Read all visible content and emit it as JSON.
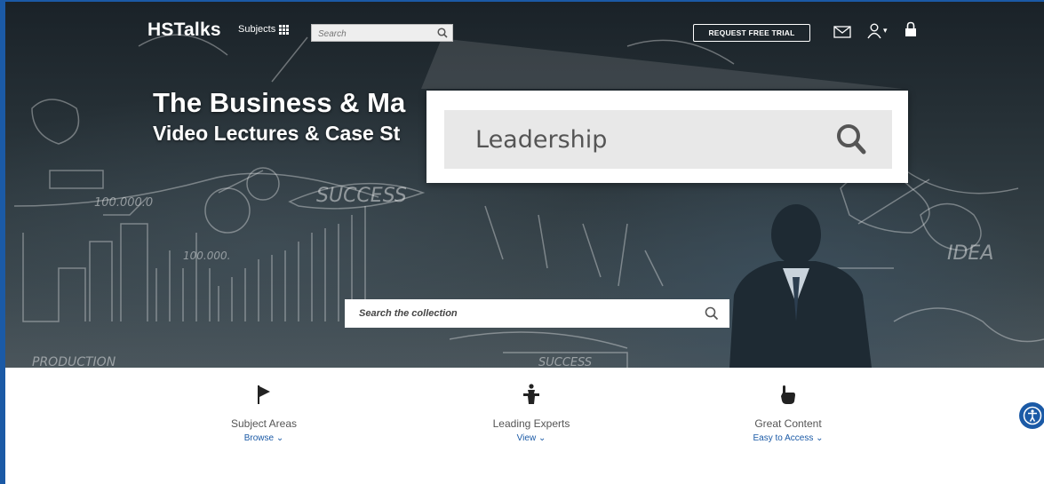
{
  "nav": {
    "logo": "HSTalks",
    "subjects_label": "Subjects",
    "search_placeholder": "Search",
    "trial_button": "REQUEST FREE TRIAL"
  },
  "hero": {
    "title": "The Business & Ma",
    "subtitle": "Video Lectures & Case St",
    "search_placeholder": "Search the collection"
  },
  "zoom": {
    "text": "Leadership"
  },
  "features": [
    {
      "icon": "flag-icon",
      "title": "Subject Areas",
      "link": "Browse ⌄"
    },
    {
      "icon": "lectern-icon",
      "title": "Leading Experts",
      "link": "View ⌄"
    },
    {
      "icon": "pointing-hand-icon",
      "title": "Great Content",
      "link": "Easy to Access ⌄"
    }
  ],
  "colors": {
    "accent": "#1b5aa6",
    "hero_dark": "#1a2228"
  }
}
